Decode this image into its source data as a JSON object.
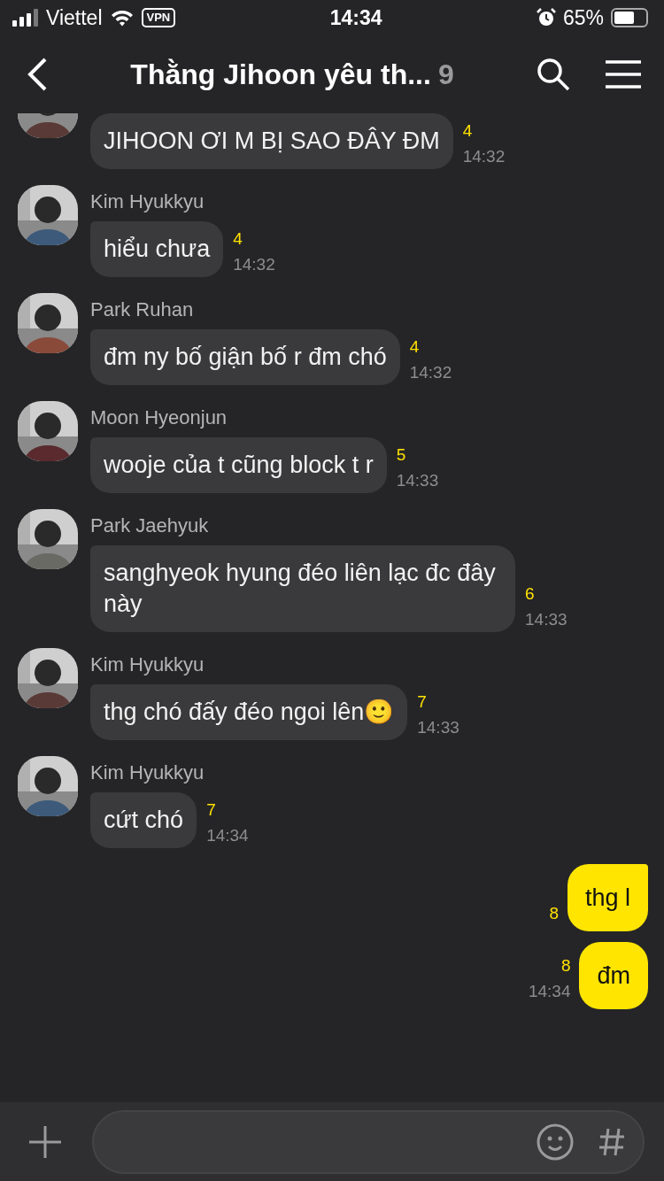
{
  "status_bar": {
    "carrier": "Viettel",
    "vpn": "VPN",
    "time": "14:34",
    "battery": "65%"
  },
  "header": {
    "title": "Thằng Jihoon yêu th...",
    "member_count": "9"
  },
  "messages": [
    {
      "kind": "incoming",
      "text": "JIHOON ƠI M BỊ SAO ĐÂY ĐM",
      "unread": "4",
      "time": "14:32"
    },
    {
      "kind": "incoming",
      "sender": "Kim Hyukkyu",
      "text": "hiểu chưa",
      "unread": "4",
      "time": "14:32"
    },
    {
      "kind": "incoming",
      "sender": "Park Ruhan",
      "text": "đm ny bố giận bố r đm chó",
      "unread": "4",
      "time": "14:32"
    },
    {
      "kind": "incoming",
      "sender": "Moon Hyeonjun",
      "text": "wooje của t cũng block t r",
      "unread": "5",
      "time": "14:33"
    },
    {
      "kind": "incoming",
      "sender": "Park Jaehyuk",
      "text": "sanghyeok hyung đéo liên lạc đc đây này",
      "unread": "6",
      "time": "14:33"
    },
    {
      "kind": "incoming",
      "sender": "Kim Hyukkyu",
      "text": "thg chó đấy đéo ngoi lên🙂",
      "unread": "7",
      "time": "14:33"
    },
    {
      "kind": "incoming",
      "sender": "Kim Hyukkyu",
      "text": "cứt chó",
      "unread": "7",
      "time": "14:34"
    },
    {
      "kind": "outgoing",
      "text": "thg l",
      "unread": "8",
      "tail": true
    },
    {
      "kind": "outgoing",
      "text": "đm",
      "unread": "8",
      "time": "14:34",
      "tail": false
    }
  ]
}
